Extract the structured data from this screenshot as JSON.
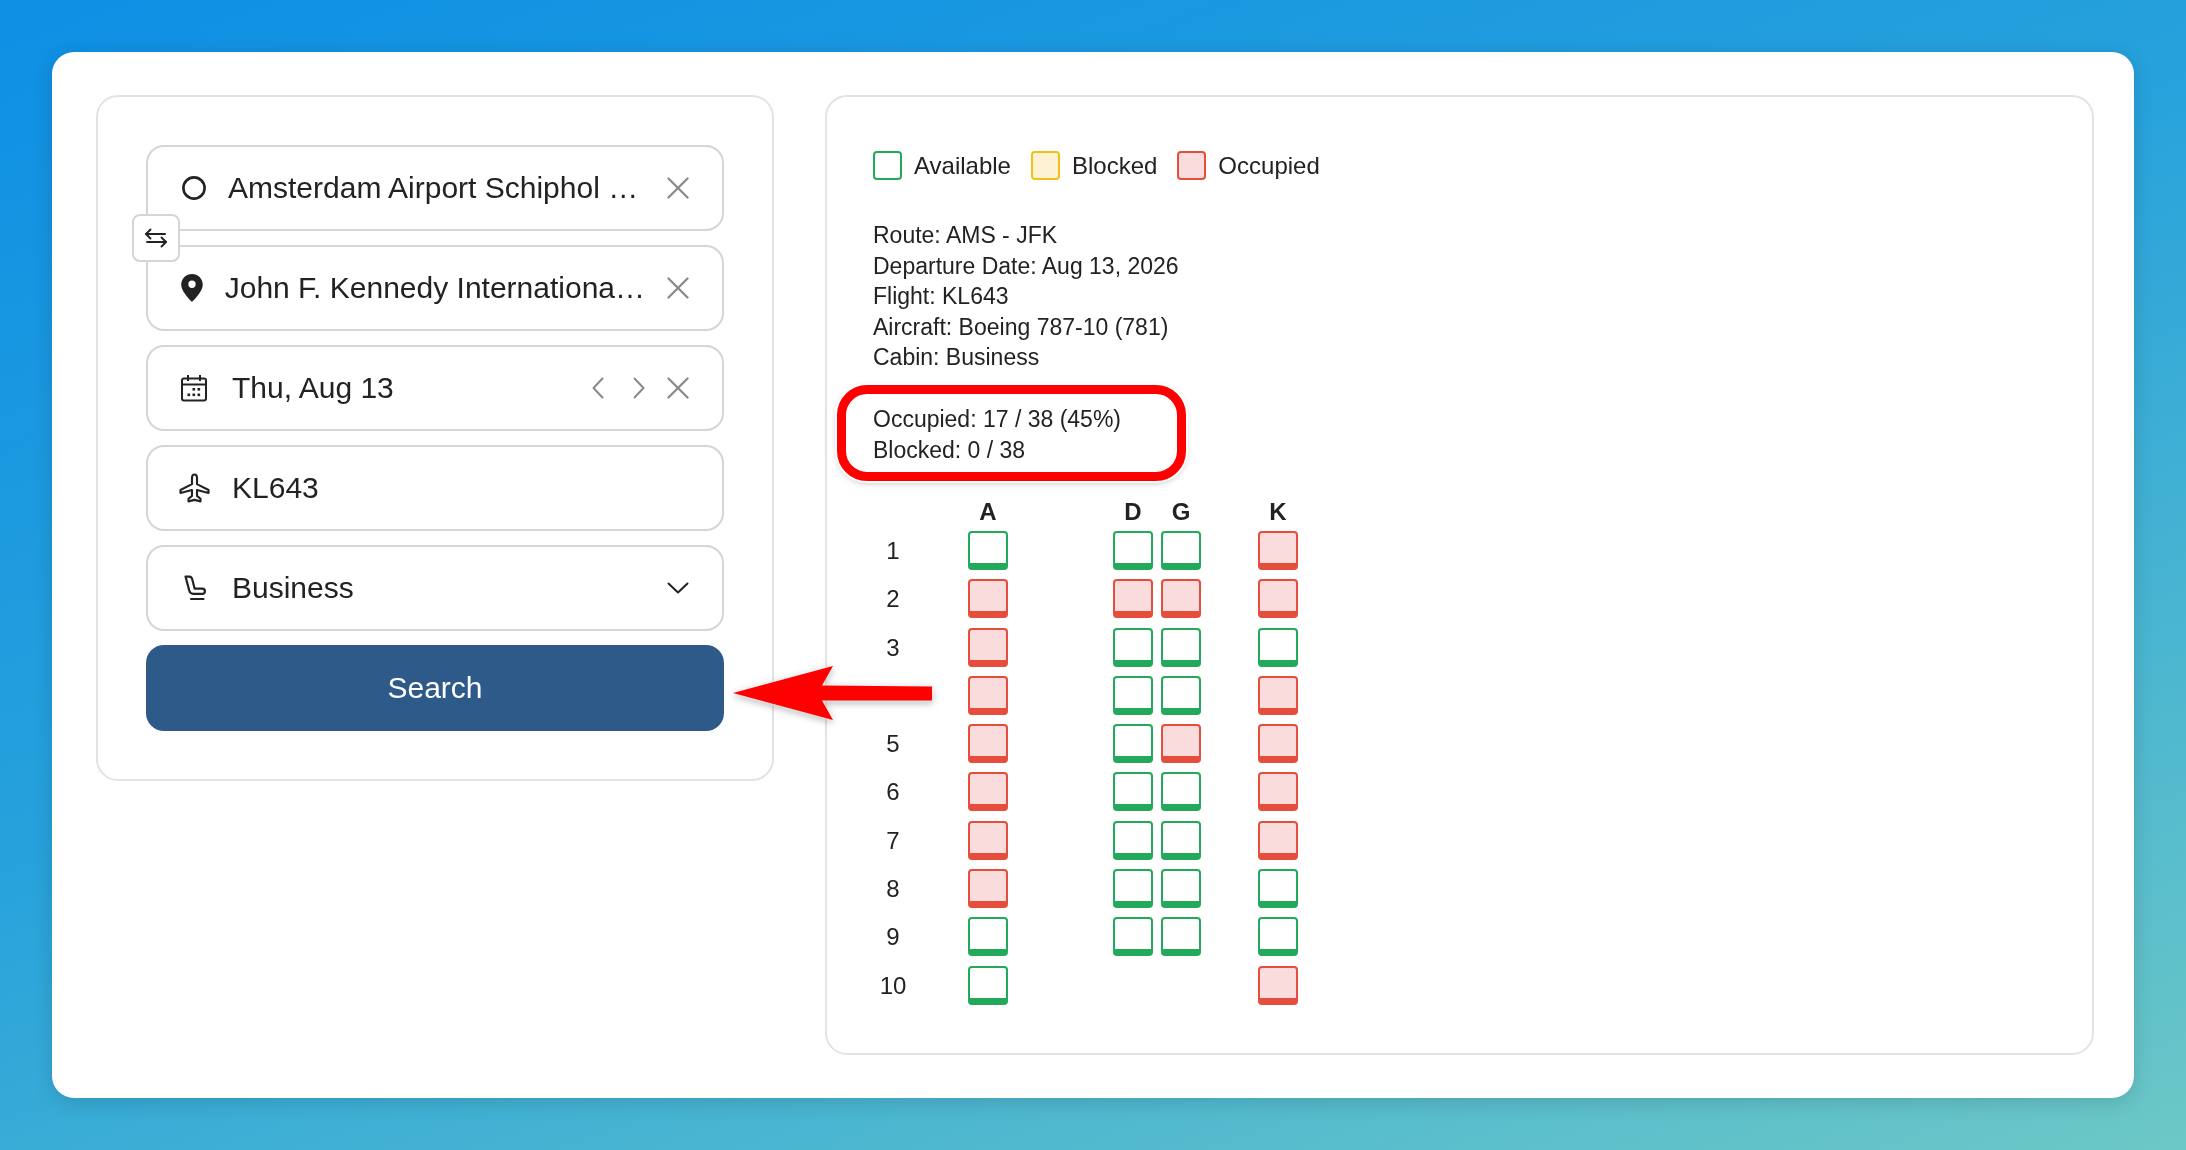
{
  "search_form": {
    "fields": [
      {
        "kind": "origin",
        "value": "Amsterdam Airport Schiphol …"
      },
      {
        "kind": "destination",
        "value": "John F. Kennedy Internationa…"
      },
      {
        "kind": "date",
        "value": "Thu, Aug 13"
      },
      {
        "kind": "flight",
        "value": "KL643"
      },
      {
        "kind": "cabin",
        "value": "Business"
      }
    ],
    "search_button": {
      "label": "Search"
    }
  },
  "seat_map_panel": {
    "legend": [
      {
        "label": "Available",
        "kind": "available"
      },
      {
        "label": "Blocked",
        "kind": "blocked"
      },
      {
        "label": "Occupied",
        "kind": "occupied"
      }
    ],
    "flight_info": [
      "Route: AMS - JFK",
      "Departure Date: Aug 13, 2026",
      "Flight: KL643",
      "Aircraft: Boeing 787-10 (781)",
      "Cabin: Business"
    ],
    "stats": [
      "Occupied: 17 / 38 (45%)",
      "Blocked: 0 / 38"
    ],
    "columns": {
      "left": [
        "A"
      ],
      "center": [
        "D",
        "G"
      ],
      "right": [
        "K"
      ]
    },
    "rows": [
      {
        "label": "1",
        "left": [
          {
            "kind": "available"
          }
        ],
        "center": [
          {
            "kind": "available"
          },
          {
            "kind": "available"
          }
        ],
        "right": [
          {
            "kind": "occupied"
          }
        ]
      },
      {
        "label": "2",
        "left": [
          {
            "kind": "occupied"
          }
        ],
        "center": [
          {
            "kind": "occupied"
          },
          {
            "kind": "occupied"
          }
        ],
        "right": [
          {
            "kind": "occupied"
          }
        ]
      },
      {
        "label": "3",
        "left": [
          {
            "kind": "occupied"
          }
        ],
        "center": [
          {
            "kind": "available"
          },
          {
            "kind": "available"
          }
        ],
        "right": [
          {
            "kind": "available"
          }
        ]
      },
      {
        "left": [
          {
            "kind": "occupied"
          }
        ],
        "center": [
          {
            "kind": "available"
          },
          {
            "kind": "available"
          }
        ],
        "right": [
          {
            "kind": "occupied"
          }
        ]
      },
      {
        "label": "5",
        "left": [
          {
            "kind": "occupied"
          }
        ],
        "center": [
          {
            "kind": "available"
          },
          {
            "kind": "occupied"
          }
        ],
        "right": [
          {
            "kind": "occupied"
          }
        ]
      },
      {
        "label": "6",
        "left": [
          {
            "kind": "occupied"
          }
        ],
        "center": [
          {
            "kind": "available"
          },
          {
            "kind": "available"
          }
        ],
        "right": [
          {
            "kind": "occupied"
          }
        ]
      },
      {
        "label": "7",
        "left": [
          {
            "kind": "occupied"
          }
        ],
        "center": [
          {
            "kind": "available"
          },
          {
            "kind": "available"
          }
        ],
        "right": [
          {
            "kind": "occupied"
          }
        ]
      },
      {
        "label": "8",
        "left": [
          {
            "kind": "occupied"
          }
        ],
        "center": [
          {
            "kind": "available"
          },
          {
            "kind": "available"
          }
        ],
        "right": [
          {
            "kind": "available"
          }
        ]
      },
      {
        "label": "9",
        "left": [
          {
            "kind": "available"
          }
        ],
        "center": [
          {
            "kind": "available"
          },
          {
            "kind": "available"
          }
        ],
        "right": [
          {
            "kind": "available"
          }
        ]
      },
      {
        "label": "10",
        "left": [
          {
            "kind": "available"
          }
        ],
        "right": [
          {
            "kind": "occupied"
          }
        ]
      }
    ]
  }
}
